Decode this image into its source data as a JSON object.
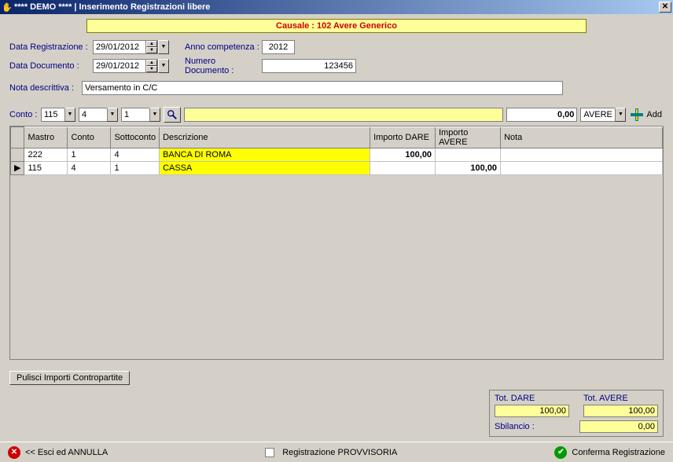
{
  "titlebar": {
    "text": "**** DEMO **** | Inserimento Registrazioni libere"
  },
  "banner": "Causale : 102 Avere Generico",
  "labels": {
    "data_reg": "Data Registrazione :",
    "data_doc": "Data Documento :",
    "anno_comp": "Anno competenza :",
    "num_doc": "Numero Documento :",
    "nota": "Nota descrittiva :",
    "conto": "Conto :",
    "add": "Add"
  },
  "fields": {
    "data_reg": "29/01/2012",
    "data_doc": "29/01/2012",
    "anno": "2012",
    "num_doc": "123456",
    "nota": "Versamento in C/C",
    "conto1": "115",
    "conto2": "4",
    "conto3": "1",
    "amount": "0,00",
    "tipo": "AVERE"
  },
  "grid": {
    "headers": {
      "mastro": "Mastro",
      "conto": "Conto",
      "sotto": "Sottoconto",
      "desc": "Descrizione",
      "dare": "Importo DARE",
      "avere": "Importo AVERE",
      "nota": "Nota"
    },
    "rows": [
      {
        "sel": "",
        "mastro": "222",
        "conto": "1",
        "sotto": "4",
        "desc": "BANCA DI ROMA",
        "dare": "100,00",
        "avere": "",
        "nota": ""
      },
      {
        "sel": "▶",
        "mastro": "115",
        "conto": "4",
        "sotto": "1",
        "desc": "CASSA",
        "dare": "",
        "avere": "100,00",
        "nota": ""
      }
    ]
  },
  "buttons": {
    "pulisci": "Pulisci Importi Contropartite",
    "esci": "<<  Esci ed ANNULLA",
    "provvisoria": "Registrazione PROVVISORIA",
    "conferma": "Conferma Registrazione"
  },
  "totals": {
    "dare_lbl": "Tot. DARE",
    "dare_val": "100,00",
    "avere_lbl": "Tot. AVERE",
    "avere_val": "100,00",
    "sbil_lbl": "Sbilancio :",
    "sbil_val": "0,00"
  }
}
